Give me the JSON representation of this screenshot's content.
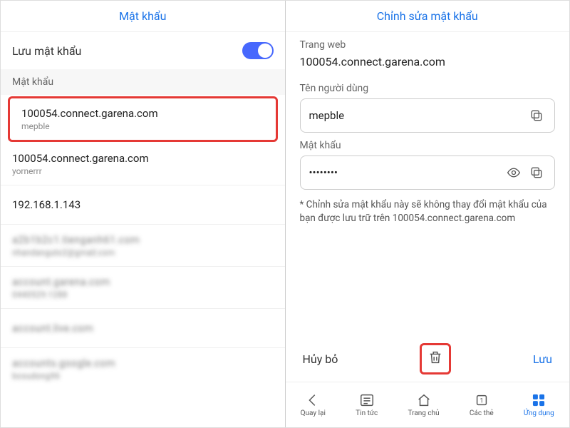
{
  "left": {
    "title": "Mật khẩu",
    "save_passwords_label": "Lưu mật khẩu",
    "toggle_on": true,
    "section_label": "Mật khẩu",
    "items": [
      {
        "site": "100054.connect.garena.com",
        "user": "mepble",
        "highlighted": true
      },
      {
        "site": "100054.connect.garena.com",
        "user": "yornerrr"
      },
      {
        "site": "192.168.1.143",
        "user": ""
      },
      {
        "site": "a2b1b2c1.tienganh61.com",
        "user": "nhandanguto2@gmail.com",
        "blurred": true
      },
      {
        "site": "account.garena.com",
        "user": "0440529.1288",
        "blurred": true
      },
      {
        "site": "account.live.com",
        "user": "",
        "blurred": true
      },
      {
        "site": "accounts.google.com",
        "user": "bcoudong96",
        "blurred": true
      }
    ]
  },
  "right": {
    "title": "Chỉnh sửa mật khẩu",
    "website_label": "Trang web",
    "website_value": "100054.connect.garena.com",
    "username_label": "Tên người dùng",
    "username_value": "mepble",
    "password_label": "Mật khẩu",
    "password_value": "••••••••",
    "note": "* Chỉnh sửa mật khẩu này sẽ không thay đổi mật khẩu của bạn được lưu trữ trên 100054.connect.garena.com",
    "cancel": "Hủy bỏ",
    "save": "Lưu"
  },
  "nav": {
    "back": "Quay lại",
    "news": "Tin tức",
    "home": "Trang chủ",
    "tabs": "Các thẻ",
    "tabs_count": "1",
    "apps": "Ứng dụng"
  }
}
